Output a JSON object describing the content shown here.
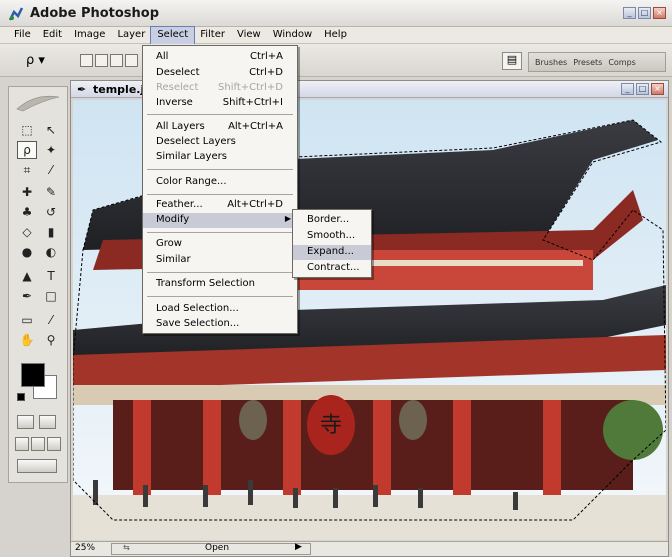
{
  "app": {
    "title": "Adobe Photoshop"
  },
  "menubar": {
    "items": [
      "File",
      "Edit",
      "Image",
      "Layer",
      "Select",
      "Filter",
      "View",
      "Window",
      "Help"
    ],
    "active": "Select"
  },
  "palette_well": {
    "tabs": [
      "Brushes",
      "Presets",
      "Comps"
    ]
  },
  "document": {
    "title": "temple.j",
    "zoom": "25%",
    "status": "Open"
  },
  "select_menu": {
    "items": [
      {
        "label": "All",
        "shortcut": "Ctrl+A"
      },
      {
        "label": "Deselect",
        "shortcut": "Ctrl+D"
      },
      {
        "label": "Reselect",
        "shortcut": "Shift+Ctrl+D",
        "disabled": true
      },
      {
        "label": "Inverse",
        "shortcut": "Shift+Ctrl+I"
      },
      {
        "label": "All Layers",
        "shortcut": "Alt+Ctrl+A"
      },
      {
        "label": "Deselect Layers",
        "shortcut": ""
      },
      {
        "label": "Similar Layers",
        "shortcut": ""
      },
      {
        "label": "Color Range...",
        "shortcut": ""
      },
      {
        "label": "Feather...",
        "shortcut": "Alt+Ctrl+D"
      },
      {
        "label": "Modify",
        "shortcut": "",
        "submenu": true,
        "highlighted": true
      },
      {
        "label": "Grow",
        "shortcut": ""
      },
      {
        "label": "Similar",
        "shortcut": ""
      },
      {
        "label": "Transform Selection",
        "shortcut": ""
      },
      {
        "label": "Load Selection...",
        "shortcut": ""
      },
      {
        "label": "Save Selection...",
        "shortcut": ""
      }
    ]
  },
  "modify_submenu": {
    "items": [
      {
        "label": "Border..."
      },
      {
        "label": "Smooth..."
      },
      {
        "label": "Expand...",
        "highlighted": true
      },
      {
        "label": "Contract..."
      }
    ]
  },
  "colors": {
    "foreground": "#000000",
    "background": "#ffffff",
    "menu_highlight": "#c8cbd6"
  },
  "icons": [
    "photoshop-app-icon",
    "lasso-icon",
    "file-browser-icon",
    "feather-logo-icon"
  ]
}
